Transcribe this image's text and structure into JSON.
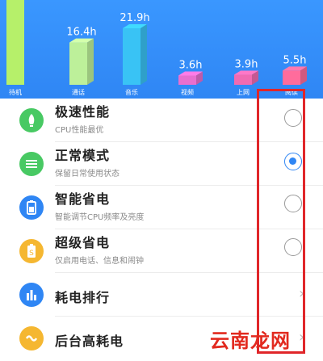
{
  "chart_data": {
    "type": "bar",
    "categories": [
      "待机",
      "通话",
      "音乐",
      "视频",
      "上网",
      "阅读"
    ],
    "values": [
      null,
      16.4,
      21.9,
      3.6,
      3.9,
      5.5
    ],
    "value_labels": [
      "",
      "16.4h",
      "21.9h",
      "3.6h",
      "3.9h",
      "5.5h"
    ],
    "colors": [
      "#b6f06a",
      "#bdf09a",
      "#39c3f5",
      "#e86fcf",
      "#f06bb2",
      "#ff6c9c"
    ]
  },
  "modes": [
    {
      "title": "极速性能",
      "subtitle": "CPU性能最优",
      "selected": false,
      "icon": "rocket-icon",
      "icon_color": "#48c963"
    },
    {
      "title": "正常模式",
      "subtitle": "保留日常使用状态",
      "selected": true,
      "icon": "balanced-icon",
      "icon_color": "#48c963"
    },
    {
      "title": "智能省电",
      "subtitle": "智能调节CPU频率及亮度",
      "selected": false,
      "icon": "smart-battery-icon",
      "icon_color": "#2f86f4"
    },
    {
      "title": "超级省电",
      "subtitle": "仅启用电话、信息和闹钟",
      "selected": false,
      "icon": "super-saver-icon",
      "icon_color": "#f5b731"
    }
  ],
  "links": [
    {
      "title": "耗电排行",
      "icon": "ranking-icon",
      "icon_color": "#2f86f4"
    },
    {
      "title": "后台高耗电",
      "icon": "background-drain-icon",
      "icon_color": "#f5b731"
    }
  ],
  "watermark": "云南龙网",
  "colors": {
    "accent": "#2f86f4",
    "highlight": "#e0262a"
  }
}
